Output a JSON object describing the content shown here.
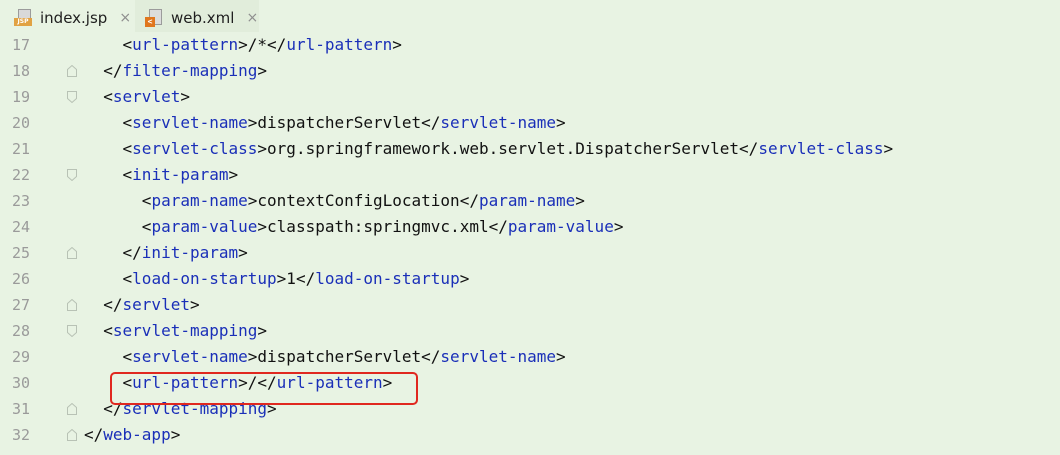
{
  "tabs": [
    {
      "label": "index.jsp",
      "icon": "jsp-file-icon",
      "icon_badge": "JSP",
      "active": false
    },
    {
      "label": "web.xml",
      "icon": "xml-file-icon",
      "icon_badge": "<",
      "active": true
    }
  ],
  "close_glyph": "×",
  "colors": {
    "background": "#E8F3E3",
    "tag_name": "#1A2FB8",
    "text": "#111111",
    "line_number": "#9A9A9A",
    "highlight_border": "#E0281F",
    "active_tab_underline": "#4A87D9"
  },
  "lines": [
    {
      "number": "17",
      "indent": "    ",
      "parts": [
        [
          "p",
          "<"
        ],
        [
          "t",
          "url-pattern"
        ],
        [
          "p",
          ">/*</"
        ],
        [
          "t",
          "url-pattern"
        ],
        [
          "p",
          ">"
        ]
      ],
      "fold": "none"
    },
    {
      "number": "18",
      "indent": "  ",
      "parts": [
        [
          "p",
          "</"
        ],
        [
          "t",
          "filter-mapping"
        ],
        [
          "p",
          ">"
        ]
      ],
      "fold": "end"
    },
    {
      "number": "19",
      "indent": "  ",
      "parts": [
        [
          "p",
          "<"
        ],
        [
          "t",
          "servlet"
        ],
        [
          "p",
          ">"
        ]
      ],
      "fold": "start"
    },
    {
      "number": "20",
      "indent": "    ",
      "parts": [
        [
          "p",
          "<"
        ],
        [
          "t",
          "servlet-name"
        ],
        [
          "p",
          ">dispatcherServlet</"
        ],
        [
          "t",
          "servlet-name"
        ],
        [
          "p",
          ">"
        ]
      ],
      "fold": "none"
    },
    {
      "number": "21",
      "indent": "    ",
      "parts": [
        [
          "p",
          "<"
        ],
        [
          "t",
          "servlet-class"
        ],
        [
          "p",
          ">org.springframework.web.servlet.DispatcherServlet</"
        ],
        [
          "t",
          "servlet-class"
        ],
        [
          "p",
          ">"
        ]
      ],
      "fold": "none"
    },
    {
      "number": "22",
      "indent": "    ",
      "parts": [
        [
          "p",
          "<"
        ],
        [
          "t",
          "init-param"
        ],
        [
          "p",
          ">"
        ]
      ],
      "fold": "start"
    },
    {
      "number": "23",
      "indent": "      ",
      "parts": [
        [
          "p",
          "<"
        ],
        [
          "t",
          "param-name"
        ],
        [
          "p",
          ">contextConfigLocation</"
        ],
        [
          "t",
          "param-name"
        ],
        [
          "p",
          ">"
        ]
      ],
      "fold": "none"
    },
    {
      "number": "24",
      "indent": "      ",
      "parts": [
        [
          "p",
          "<"
        ],
        [
          "t",
          "param-value"
        ],
        [
          "p",
          ">classpath:springmvc.xml</"
        ],
        [
          "t",
          "param-value"
        ],
        [
          "p",
          ">"
        ]
      ],
      "fold": "none"
    },
    {
      "number": "25",
      "indent": "    ",
      "parts": [
        [
          "p",
          "</"
        ],
        [
          "t",
          "init-param"
        ],
        [
          "p",
          ">"
        ]
      ],
      "fold": "end"
    },
    {
      "number": "26",
      "indent": "    ",
      "parts": [
        [
          "p",
          "<"
        ],
        [
          "t",
          "load-on-startup"
        ],
        [
          "p",
          ">1</"
        ],
        [
          "t",
          "load-on-startup"
        ],
        [
          "p",
          ">"
        ]
      ],
      "fold": "none"
    },
    {
      "number": "27",
      "indent": "  ",
      "parts": [
        [
          "p",
          "</"
        ],
        [
          "t",
          "servlet"
        ],
        [
          "p",
          ">"
        ]
      ],
      "fold": "end"
    },
    {
      "number": "28",
      "indent": "  ",
      "parts": [
        [
          "p",
          "<"
        ],
        [
          "t",
          "servlet-mapping"
        ],
        [
          "p",
          ">"
        ]
      ],
      "fold": "start"
    },
    {
      "number": "29",
      "indent": "    ",
      "parts": [
        [
          "p",
          "<"
        ],
        [
          "t",
          "servlet-name"
        ],
        [
          "p",
          ">dispatcherServlet</"
        ],
        [
          "t",
          "servlet-name"
        ],
        [
          "p",
          ">"
        ]
      ],
      "fold": "none"
    },
    {
      "number": "30",
      "indent": "    ",
      "parts": [
        [
          "p",
          "<"
        ],
        [
          "t",
          "url-pattern"
        ],
        [
          "p",
          ">/</"
        ],
        [
          "t",
          "url-pattern"
        ],
        [
          "p",
          ">"
        ]
      ],
      "fold": "none",
      "highlighted": true
    },
    {
      "number": "31",
      "indent": "  ",
      "parts": [
        [
          "p",
          "</"
        ],
        [
          "t",
          "servlet-mapping"
        ],
        [
          "p",
          ">"
        ]
      ],
      "fold": "end"
    },
    {
      "number": "32",
      "indent": "",
      "parts": [
        [
          "p",
          "</"
        ],
        [
          "t",
          "web-app"
        ],
        [
          "p",
          ">"
        ]
      ],
      "fold": "end"
    }
  ]
}
